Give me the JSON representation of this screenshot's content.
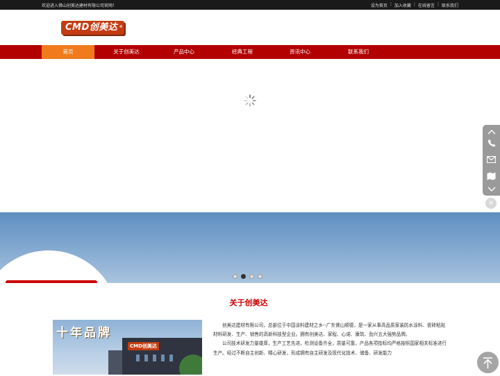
{
  "topbar": {
    "welcome": "欢迎进入佛山创美达建材有限公司官网！",
    "links": [
      "设为首页",
      "加入收藏",
      "在线留言",
      "联系我们"
    ],
    "separator": "|"
  },
  "logo": {
    "text": "CMD创美达",
    "reg": "®"
  },
  "nav": {
    "items": [
      "首页",
      "关于创美达",
      "产品中心",
      "经典工程",
      "资讯中心",
      "联系我们"
    ],
    "active_index": 0
  },
  "slider": {
    "slide_count": 4,
    "active_index": 1
  },
  "about": {
    "title": "关于创美达",
    "image_slogan": "十年品牌",
    "image_sign": "CMD创美达",
    "paragraphs": [
      "创美达建材有限公司，总部位于中国涂料建材之乡--广东佛山顺德，是一家从事高品质家装防水涂料、瓷砖粘贴材料研发、生产、销售的高新科技型企业。拥有创美达、家程、心诺、康筑、劲兴五大强势品牌。",
      "公司技术研发力量雄厚，生产工艺先进，检测设备齐全，质量可靠，产品各项指标均严格按照国家相关标准进行生产。经过不断自主创新、精心研发，形成拥有自主研发及现代化技术、储备、研发能力"
    ]
  },
  "sidebar": {
    "icons": [
      "chevron-up-icon",
      "phone-icon",
      "mail-icon",
      "map-icon",
      "chevron-down-icon"
    ],
    "close": "×"
  },
  "colors": {
    "nav_red": "#b30000",
    "nav_active": "#f07a1c",
    "title_red": "#cc0000",
    "logo_orange": "#c43c12"
  }
}
